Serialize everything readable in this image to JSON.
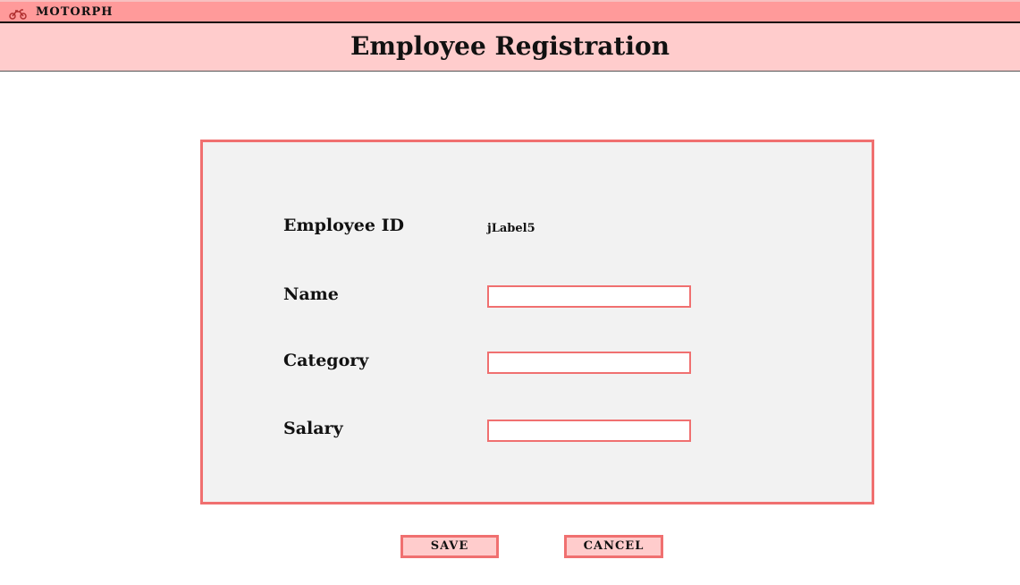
{
  "window": {
    "title": "MOTORPH",
    "icon": "motorcycle-icon"
  },
  "header": {
    "title": "Employee Registration"
  },
  "form": {
    "employee_id": {
      "label": "Employee ID",
      "value": "jLabel5"
    },
    "name": {
      "label": "Name",
      "value": ""
    },
    "category": {
      "label": "Category",
      "value": ""
    },
    "salary": {
      "label": "Salary",
      "value": ""
    }
  },
  "buttons": {
    "save": "SAVE",
    "cancel": "CANCEL"
  },
  "colors": {
    "titlebar": "#ff9a9a",
    "header": "#ffcccc",
    "panel_bg": "#f2f2f2",
    "accent_border": "#f07070"
  }
}
